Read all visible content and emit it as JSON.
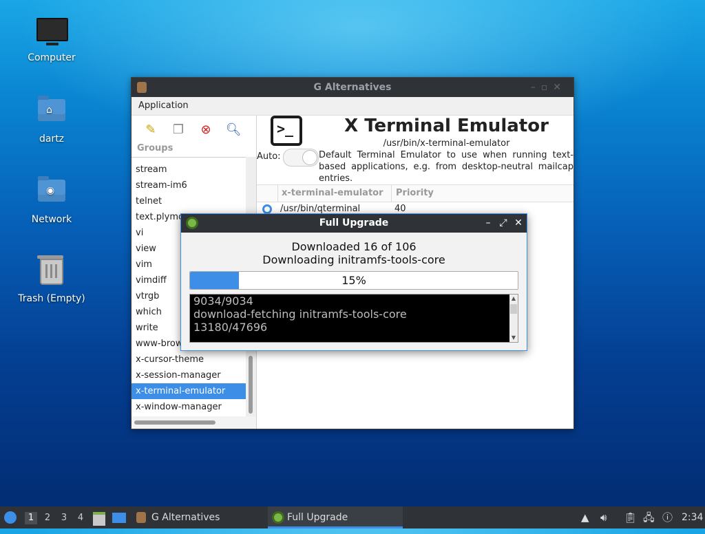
{
  "desktop": {
    "icons": [
      {
        "label": "Computer"
      },
      {
        "label": "dartz"
      },
      {
        "label": "Network"
      },
      {
        "label": "Trash (Empty)"
      }
    ]
  },
  "galt": {
    "title": "G Alternatives",
    "menu": "Application",
    "groups_header": "Groups",
    "groups": [
      "stream",
      "stream-im6",
      "telnet",
      "text.plymo",
      "vi",
      "view",
      "vim",
      "vimdiff",
      "vtrgb",
      "which",
      "write",
      "www-brow",
      "x-cursor-theme",
      "x-session-manager",
      "x-terminal-emulator",
      "x-window-manager"
    ],
    "selected_group": "x-terminal-emulator",
    "alt_title": "X Terminal Emulator",
    "alt_path": "/usr/bin/x-terminal-emulator",
    "auto_label": "Auto:",
    "description": "Default Terminal Emulator to use when running text-based applications, e.g. from desktop-neutral mailcap entries.",
    "col_name": "x-terminal-emulator",
    "col_priority": "Priority",
    "rows": [
      {
        "path": "/usr/bin/qterminal",
        "priority": "40"
      }
    ]
  },
  "upgrade": {
    "title": "Full Upgrade",
    "line1": "Downloaded 16 of 106",
    "line2": "Downloading initramfs-tools-core",
    "progress_text": "15%",
    "progress": 15,
    "log": [
      "9034/9034",
      "download-fetching initramfs-tools-core",
      "13180/47696"
    ]
  },
  "taskbar": {
    "workspaces": [
      "1",
      "2",
      "3",
      "4"
    ],
    "tasks": [
      {
        "label": "G Alternatives"
      },
      {
        "label": "Full Upgrade"
      }
    ],
    "clock": "2:34"
  },
  "colors": {
    "accent": "#3d8ee6",
    "titlebar": "#2f3338"
  }
}
